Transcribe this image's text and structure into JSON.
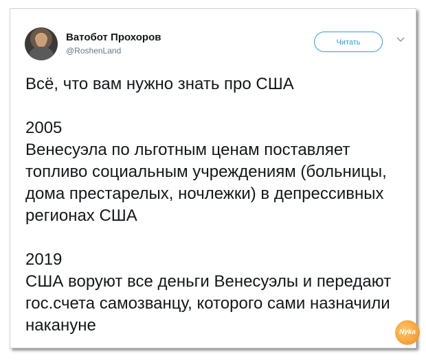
{
  "tweet": {
    "author_name": "Ватобот Прохоров",
    "author_handle": "@RoshenLand",
    "follow_label": "Читать",
    "text": "Всё, что вам нужно знать про США\n\n2005\nВенесуэла по льготным ценам поставляет топливо социальным учреждениям (больницы, дома престарелых, ночлежки) в депрессивных регионах США\n\n2019\nСША воруют все деньги Венесуэлы и передают гос.счета самозванцу, которого сами назначили накануне"
  },
  "watermark": {
    "text": "Nyka"
  },
  "icons": {
    "avatar": "avatar-photo",
    "menu": "chevron-down-icon"
  },
  "colors": {
    "accent": "#2b9be8",
    "text": "#14171a",
    "muted": "#657786"
  }
}
